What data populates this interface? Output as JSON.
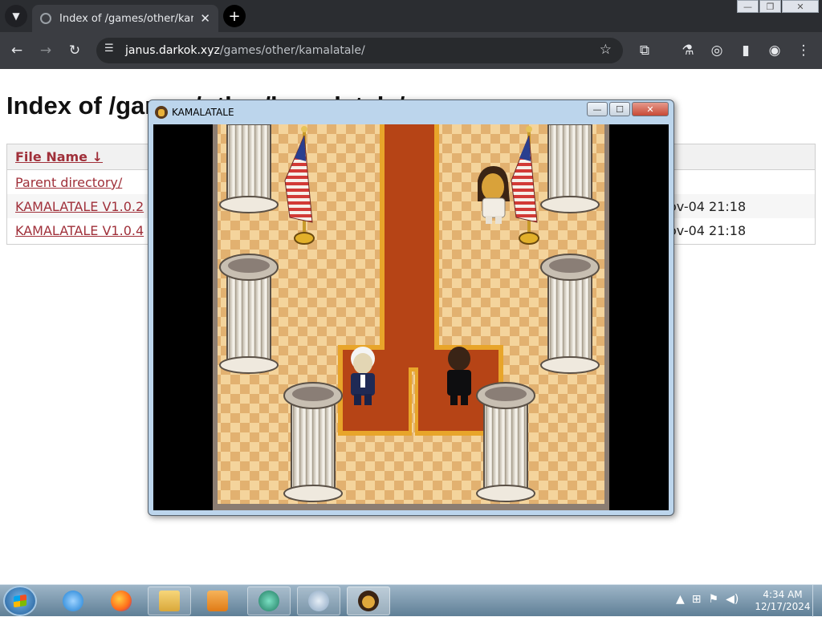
{
  "browser": {
    "tab_title": "Index of /games/other/kamala",
    "tab_close": "✕",
    "new_tab": "+",
    "address_domain": "janus.darkok.xyz",
    "address_path": "/games/other/kamalatale/"
  },
  "page": {
    "title": "Index of /games/other/kamalatale/",
    "header_file_name": "File Name  ↓",
    "rows": [
      {
        "name": "Parent directory/",
        "date": ""
      },
      {
        "name": "KAMALATALE V1.0.2",
        "date": "ov-04 21:18"
      },
      {
        "name": "KAMALATALE V1.0.4",
        "date": "ov-04 21:18"
      }
    ]
  },
  "game_window": {
    "title": "KAMALATALE",
    "minimize": "—",
    "maximize": "☐",
    "close": "✕"
  },
  "taskbar": {
    "time": "4:34 AM",
    "date": "12/17/2024",
    "apps": [
      "internet-explorer",
      "firefox",
      "file-explorer",
      "media-player",
      "app-launcher",
      "control-panel",
      "kamalatale"
    ]
  },
  "colors": {
    "chrome_dark": "#2b2d31",
    "link": "#a0303a",
    "carpet": "#b64416",
    "carpet_trim": "#e8a52a",
    "floor_light": "#f4d49c",
    "floor_dark": "#e2b170"
  }
}
